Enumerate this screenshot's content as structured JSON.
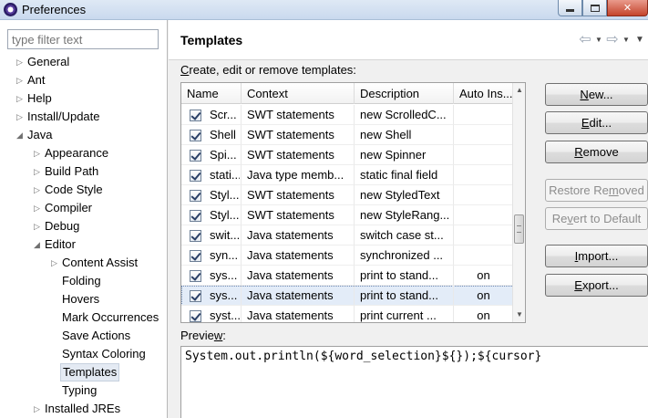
{
  "window": {
    "title": "Preferences",
    "icons": {
      "app": "eclipse-icon",
      "minimize": "minimize-icon",
      "maximize": "maximize-icon",
      "close": "close-icon"
    },
    "close_glyph": "✕"
  },
  "sidebar": {
    "filter_placeholder": "type filter text",
    "items": [
      {
        "label": "General",
        "level": 0,
        "arrow": "▷"
      },
      {
        "label": "Ant",
        "level": 0,
        "arrow": "▷"
      },
      {
        "label": "Help",
        "level": 0,
        "arrow": "▷"
      },
      {
        "label": "Install/Update",
        "level": 0,
        "arrow": "▷"
      },
      {
        "label": "Java",
        "level": 0,
        "arrow": "◢"
      },
      {
        "label": "Appearance",
        "level": 1,
        "arrow": "▷"
      },
      {
        "label": "Build Path",
        "level": 1,
        "arrow": "▷"
      },
      {
        "label": "Code Style",
        "level": 1,
        "arrow": "▷"
      },
      {
        "label": "Compiler",
        "level": 1,
        "arrow": "▷"
      },
      {
        "label": "Debug",
        "level": 1,
        "arrow": "▷"
      },
      {
        "label": "Editor",
        "level": 1,
        "arrow": "◢"
      },
      {
        "label": "Content Assist",
        "level": 2,
        "arrow": "▷"
      },
      {
        "label": "Folding",
        "level": 2,
        "arrow": ""
      },
      {
        "label": "Hovers",
        "level": 2,
        "arrow": ""
      },
      {
        "label": "Mark Occurrences",
        "level": 2,
        "arrow": ""
      },
      {
        "label": "Save Actions",
        "level": 2,
        "arrow": ""
      },
      {
        "label": "Syntax Coloring",
        "level": 2,
        "arrow": ""
      },
      {
        "label": "Templates",
        "level": 2,
        "arrow": "",
        "selected": true
      },
      {
        "label": "Typing",
        "level": 2,
        "arrow": ""
      },
      {
        "label": "Installed JREs",
        "level": 1,
        "arrow": "▷"
      }
    ]
  },
  "page": {
    "title": "Templates",
    "nav": {
      "back_glyph": "⇦",
      "forward_glyph": "⇨",
      "dropdown_glyph": "▼",
      "menu_glyph": "▼",
      "back_icon": "back-arrow-icon",
      "forward_icon": "forward-arrow-icon"
    },
    "description": "Create, edit or remove templates:",
    "description_mnemonic": "C",
    "description_rest": "reate, edit or remove templates:"
  },
  "table": {
    "columns": [
      "Name",
      "Context",
      "Description",
      "Auto Ins..."
    ],
    "rows": [
      {
        "name": "Scr...",
        "context": "SWT statements",
        "description": "new ScrolledC...",
        "auto": ""
      },
      {
        "name": "Shell",
        "context": "SWT statements",
        "description": "new Shell",
        "auto": ""
      },
      {
        "name": "Spi...",
        "context": "SWT statements",
        "description": "new Spinner",
        "auto": ""
      },
      {
        "name": "stati...",
        "context": "Java type memb...",
        "description": "static final field",
        "auto": ""
      },
      {
        "name": "Styl...",
        "context": "SWT statements",
        "description": "new StyledText",
        "auto": ""
      },
      {
        "name": "Styl...",
        "context": "SWT statements",
        "description": "new StyleRang...",
        "auto": ""
      },
      {
        "name": "swit...",
        "context": "Java statements",
        "description": "switch case st...",
        "auto": ""
      },
      {
        "name": "syn...",
        "context": "Java statements",
        "description": "synchronized ...",
        "auto": ""
      },
      {
        "name": "sys...",
        "context": "Java statements",
        "description": "print to stand...",
        "auto": "on"
      },
      {
        "name": "sys...",
        "context": "Java statements",
        "description": "print to stand...",
        "auto": "on",
        "selected": true
      },
      {
        "name": "syst...",
        "context": "Java statements",
        "description": "print current ...",
        "auto": "on"
      }
    ],
    "scroll_up_glyph": "▲",
    "scroll_down_glyph": "▼"
  },
  "buttons": {
    "new": {
      "mn": "N",
      "rest": "ew..."
    },
    "edit": {
      "mn": "E",
      "rest": "dit..."
    },
    "remove": {
      "mn": "R",
      "rest": "emove"
    },
    "restore_removed": {
      "pre": "Restore Re",
      "mn": "m",
      "rest": "oved"
    },
    "revert_default": {
      "pre": "Re",
      "mn": "v",
      "rest": "ert to Default"
    },
    "import": {
      "mn": "I",
      "rest": "mport..."
    },
    "export": {
      "mn": "E",
      "rest": "xport..."
    }
  },
  "preview": {
    "label_pre": "Previe",
    "label_mn": "w",
    "label_post": ":",
    "code": "System.out.println(${word_selection}${});${cursor}"
  }
}
